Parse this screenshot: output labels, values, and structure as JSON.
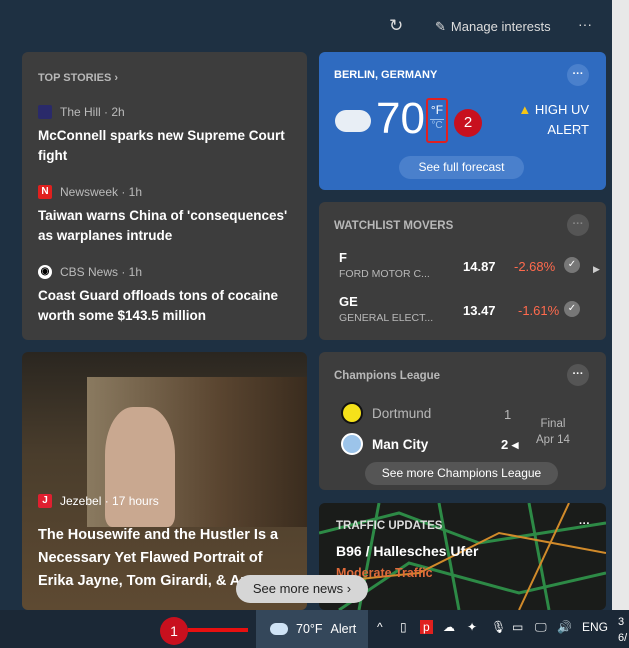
{
  "topbar": {
    "refresh_icon": "refresh-icon",
    "manage_label": "Manage interests",
    "more_label": "···"
  },
  "top_stories": {
    "title": "TOP STORIES",
    "items": [
      {
        "source": "The Hill · 2h",
        "headline": "McConnell sparks new Supreme Court fight"
      },
      {
        "source": "Newsweek · 1h",
        "headline": "Taiwan warns China of 'consequences' as warplanes intrude"
      },
      {
        "source": "CBS News · 1h",
        "headline": "Coast Guard offloads tons of cocaine worth some $143.5 million"
      }
    ]
  },
  "feature": {
    "source": "Jezebel · 17 hours",
    "headline": "The Housewife and the Hustler Is a Necessary Yet Flawed Portrait of Erika Jayne, Tom Girardi, & An..."
  },
  "see_more_news": "See more news",
  "weather": {
    "location": "BERLIN, GERMANY",
    "temp": "70",
    "unit_f": "°F",
    "unit_c": "°C",
    "alert_line1": "HIGH UV",
    "alert_line2": "ALERT",
    "forecast_button": "See full forecast",
    "badge": "2",
    "bg_color": "#2f6bc0"
  },
  "watchlist": {
    "title": "WATCHLIST MOVERS",
    "items": [
      {
        "symbol": "F",
        "name": "FORD MOTOR C...",
        "price": "14.87",
        "change": "-2.68%"
      },
      {
        "symbol": "GE",
        "name": "GENERAL ELECT...",
        "price": "13.47",
        "change": "-1.61%"
      }
    ],
    "negative_color": "#ff6a4d"
  },
  "champions": {
    "title": "Champions League",
    "team1": "Dortmund",
    "score1": "1",
    "team2": "Man City",
    "score2": "2",
    "status": "Final",
    "date": "Apr 14",
    "button": "See more Champions League"
  },
  "traffic": {
    "title": "TRAFFIC UPDATES",
    "road": "B96 / Hallesches Ufer",
    "status": "Moderate Traffic"
  },
  "taskbar": {
    "badge": "1",
    "weather": "70°F",
    "alert": "Alert",
    "lang": "ENG",
    "clock_line1": "3",
    "clock_line2": "6/"
  }
}
